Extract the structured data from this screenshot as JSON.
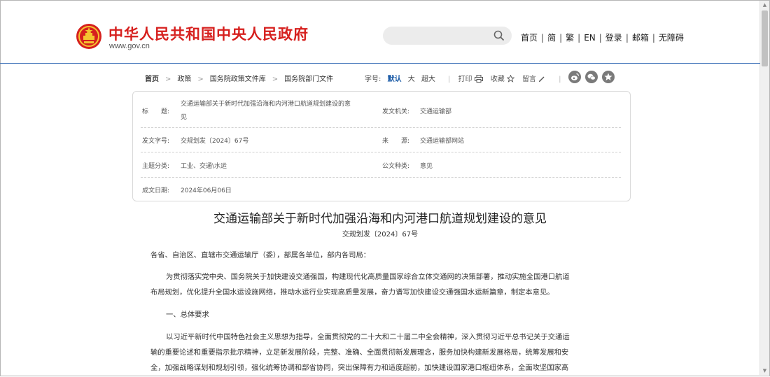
{
  "header": {
    "site_title": "中华人民共和国中央人民政府",
    "site_url": "www.gov.cn",
    "emblem_icon": "national-emblem-icon",
    "nav": [
      "首页",
      "简",
      "繁",
      "EN",
      "登录",
      "邮箱",
      "无障碍"
    ]
  },
  "breadcrumb": [
    "首页",
    "政策",
    "国务院政策文件库",
    "国务院部门文件"
  ],
  "font_size": {
    "label": "字号:",
    "options": [
      "默认",
      "大",
      "超大"
    ],
    "selected": "默认"
  },
  "tools": {
    "print": "打印",
    "favorite": "收藏",
    "comment": "留言"
  },
  "share_icons": [
    "weibo-icon",
    "wechat-icon",
    "qzone-icon"
  ],
  "info": {
    "title_label": "标　　题:",
    "title_value_line1": "交通运输部关于新时代加强沿海和内河港口航道规划建设的意",
    "title_value_line2": "见",
    "issuer_label": "发文机关:",
    "issuer_value": "交通运输部",
    "doc_no_label": "发文字号:",
    "doc_no_value": "交规划发〔2024〕67号",
    "source_label": "来　　源:",
    "source_value": "交通运输部网站",
    "topic_label": "主题分类:",
    "topic_value": "工业、交通\\水运",
    "type_label": "公文种类:",
    "type_value": "意见",
    "date_label": "成文日期:",
    "date_value": "2024年06月06日"
  },
  "article": {
    "title": "交通运输部关于新时代加强沿海和内河港口航道规划建设的意见",
    "doc_no": "交规划发〔2024〕67号",
    "salutation": "各省、自治区、直辖市交通运输厅（委），部属各单位，部内各司局：",
    "para1_line1": "为贯彻落实党中央、国务院关于加快建设交通强国，构建现代化高质量国家综合立体交通网的决策部署，推动实施全国港口航道",
    "para1_line2": "布局规划，优化提升全国水运设施网络，推动水运行业实现高质量发展，奋力谱写加快建设交通强国水运新篇章，制定本意见。",
    "section1": "一、总体要求",
    "para2_line1": "以习近平新时代中国特色社会主义思想为指导，全面贯彻党的二十大和二十届二中全会精神，深入贯彻习近平总书记关于交通运",
    "para2_line2": "输的重要论述和重要指示批示精神，立足新发展阶段，完整、准确、全面贯彻新发展理念，服务加快构建新发展格局，统筹发展和安",
    "para2_line3": "全，加强战略谋划和规划引领，强化统筹协调和部省协同，突出保障有力和适度超前，加快建设国家港口枢纽体系，全面攻坚国家高"
  },
  "colors": {
    "brand_red": "#d6201e",
    "header_rule": "#3a6fb7",
    "active_blue": "#1a5aa6"
  }
}
